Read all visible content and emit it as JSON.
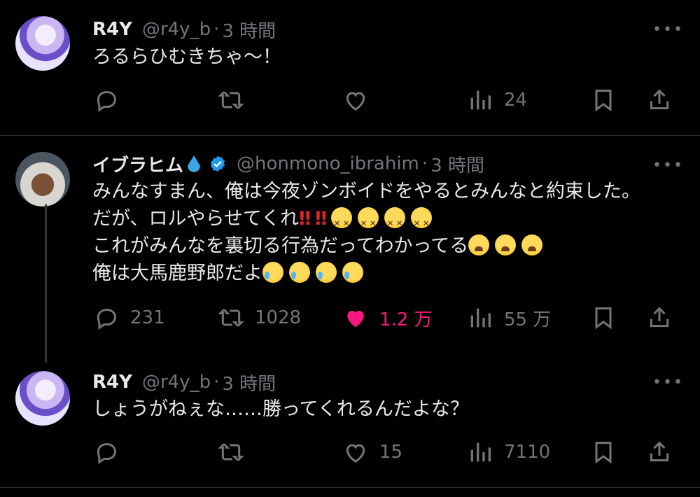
{
  "tweets": [
    {
      "name": "R4Y",
      "handle": "@r4y_b",
      "sep": "·",
      "time": "3 時間",
      "text": "ろるらひむきちゃ〜！",
      "replies": "",
      "retweets": "",
      "likes": "",
      "views": "24"
    },
    {
      "name": "イブラヒム",
      "name_emoji": "droplet-emoji",
      "verified_icon": "verified-badge-icon",
      "handle": "@honmono_ibrahim",
      "sep": "·",
      "time": "3 時間",
      "lines": [
        "みんなすまん、俺は今夜ゾンボイドをやるとみんなと約束した。",
        "だが、ロルやらせてくれ",
        "これがみんなを裏切る行為だってわかってる",
        "俺は大馬鹿野郎だよ"
      ],
      "bangs": "‼",
      "replies": "231",
      "retweets": "1028",
      "likes": "1.2 万",
      "views": "55 万",
      "liked": true
    },
    {
      "name": "R4Y",
      "handle": "@r4y_b",
      "sep": "·",
      "time": "3 時間",
      "text": "しょうがねぇな……勝ってくれるんだよな？",
      "replies": "",
      "retweets": "",
      "likes": "15",
      "views": "7110"
    }
  ],
  "more_label": "•••",
  "colors": {
    "background": "#000000",
    "text": "#e7e9ea",
    "muted": "#71767b",
    "like": "#f91880",
    "verified": "#1d9bf0"
  }
}
